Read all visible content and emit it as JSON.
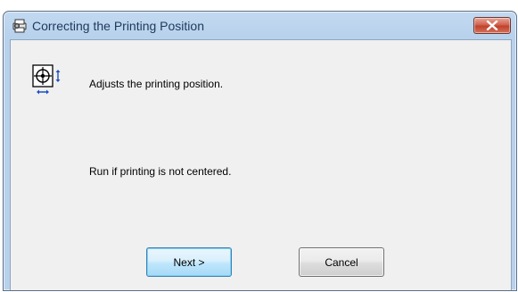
{
  "window": {
    "title": "Correcting the Printing Position",
    "close_label": "Close"
  },
  "content": {
    "description": "Adjusts the printing position.",
    "note": "Run if printing is not centered."
  },
  "buttons": {
    "next": "Next >",
    "cancel": "Cancel"
  },
  "icons": {
    "title": "printer-settings-icon",
    "main": "print-position-crosshair-icon",
    "close": "close-icon"
  },
  "colors": {
    "titlebar": "#b8d1ec",
    "client_bg": "#f0f0f0",
    "close_button": "#c0422c",
    "default_button_border": "#3c7fb1",
    "title_text": "#1e395b"
  }
}
